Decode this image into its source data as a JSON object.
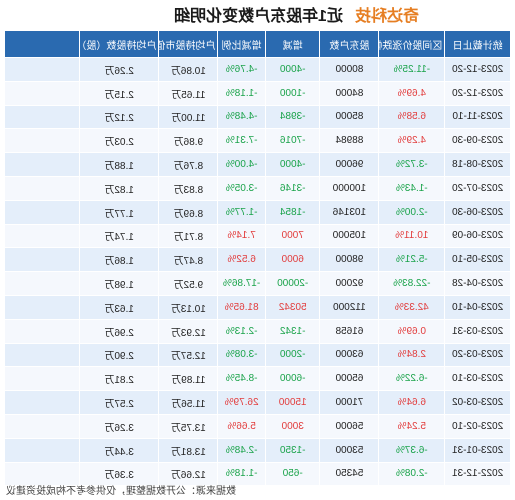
{
  "title": {
    "brand": "奇达科技",
    "text": "近1年股东户数变化明细"
  },
  "table": {
    "headers": [
      "统计截止日",
      "区间股价涨跌幅",
      "股东户数",
      "增减",
      "增减比例",
      "户均持股市值（元）",
      "户均持股数（股）"
    ],
    "rows": [
      [
        "2023-12-20",
        "-11.25%",
        "80000",
        "-4000",
        "-4.76%",
        "10.86万",
        "2.26万"
      ],
      [
        "2023-12-20",
        "4.69%",
        "84000",
        "-1000",
        "-1.18%",
        "11.65万",
        "2.15万"
      ],
      [
        "2023-11-10",
        "6.58%",
        "85000",
        "-3984",
        "-4.48%",
        "11.00万",
        "2.12万"
      ],
      [
        "2023-09-30",
        "4.29%",
        "88984",
        "-7016",
        "-7.31%",
        "9.86万",
        "2.03万"
      ],
      [
        "2023-08-18",
        "-3.72%",
        "96000",
        "-4000",
        "-4.00%",
        "8.76万",
        "1.88万"
      ],
      [
        "2023-07-20",
        "-1.43%",
        "100000",
        "-3146",
        "-3.05%",
        "8.83万",
        "1.82万"
      ],
      [
        "2023-06-30",
        "-2.00%",
        "103146",
        "-1854",
        "-1.77%",
        "8.69万",
        "1.77万"
      ],
      [
        "2023-06-09",
        "10.11%",
        "105000",
        "7000",
        "7.14%",
        "8.71万",
        "1.74万"
      ],
      [
        "2023-05-10",
        "-5.21%",
        "98000",
        "6000",
        "6.52%",
        "8.47万",
        "1.86万"
      ],
      [
        "2023-04-28",
        "-22.83%",
        "92000",
        "-20000",
        "-17.86%",
        "9.52万",
        "1.98万"
      ],
      [
        "2023-04-10",
        "42.33%",
        "112000",
        "50342",
        "81.65%",
        "10.13万",
        "1.63万"
      ],
      [
        "2023-03-31",
        "0.69%",
        "61658",
        "-1342",
        "-2.13%",
        "12.93万",
        "2.96万"
      ],
      [
        "2023-03-20",
        "2.84%",
        "63000",
        "-2000",
        "-3.08%",
        "12.57万",
        "2.90万"
      ],
      [
        "2023-03-10",
        "-6.22%",
        "65000",
        "-6000",
        "-8.45%",
        "11.89万",
        "2.81万"
      ],
      [
        "2023-03-02",
        "6.64%",
        "71000",
        "15000",
        "26.79%",
        "11.56万",
        "2.57万"
      ],
      [
        "2023-02-10",
        "5.24%",
        "56000",
        "3000",
        "5.66%",
        "13.75万",
        "3.26万"
      ],
      [
        "2023-01-31",
        "-6.37%",
        "53000",
        "-1350",
        "-2.48%",
        "13.81万",
        "3.44万"
      ],
      [
        "2022-12-31",
        "-2.08%",
        "54350",
        "-650",
        "-1.18%",
        "12.66万",
        "3.36万"
      ]
    ]
  },
  "footer": "数据来源：公开数据整理，仅供参考不构成投资建议"
}
